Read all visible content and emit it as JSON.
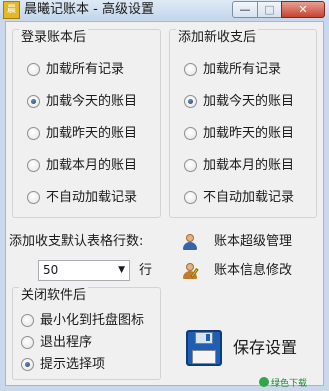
{
  "window": {
    "title": "晨曦记账本 - 高级设置",
    "app_icon_text": "晨",
    "min_glyph": "—",
    "max_glyph": "□",
    "close_glyph": "✕"
  },
  "login_group": {
    "title": "登录账本后",
    "options": [
      "加载所有记录",
      "加载今天的账目",
      "加载昨天的账目",
      "加载本月的账目",
      "不自动加载记录"
    ],
    "selected_index": 1
  },
  "add_group": {
    "title": "添加新收支后",
    "options": [
      "加载所有记录",
      "加载今天的账目",
      "加载昨天的账目",
      "加载本月的账目",
      "不自动加载记录"
    ],
    "selected_index": 1
  },
  "rows_setting": {
    "label": "添加收支默认表格行数:",
    "value": "50",
    "unit": "行"
  },
  "links": {
    "super_admin": "账本超级管理",
    "info_edit": "账本信息修改"
  },
  "close_group": {
    "title": "关闭软件后",
    "options": [
      "最小化到托盘图标",
      "退出程序",
      "提示选择项"
    ],
    "selected_index": 2
  },
  "save_button": {
    "label": "保存设置"
  },
  "watermark": {
    "text": "绿色下载"
  },
  "icons": {
    "admin": "user-icon",
    "edit": "user-edit-icon",
    "save": "floppy-disk-icon"
  }
}
